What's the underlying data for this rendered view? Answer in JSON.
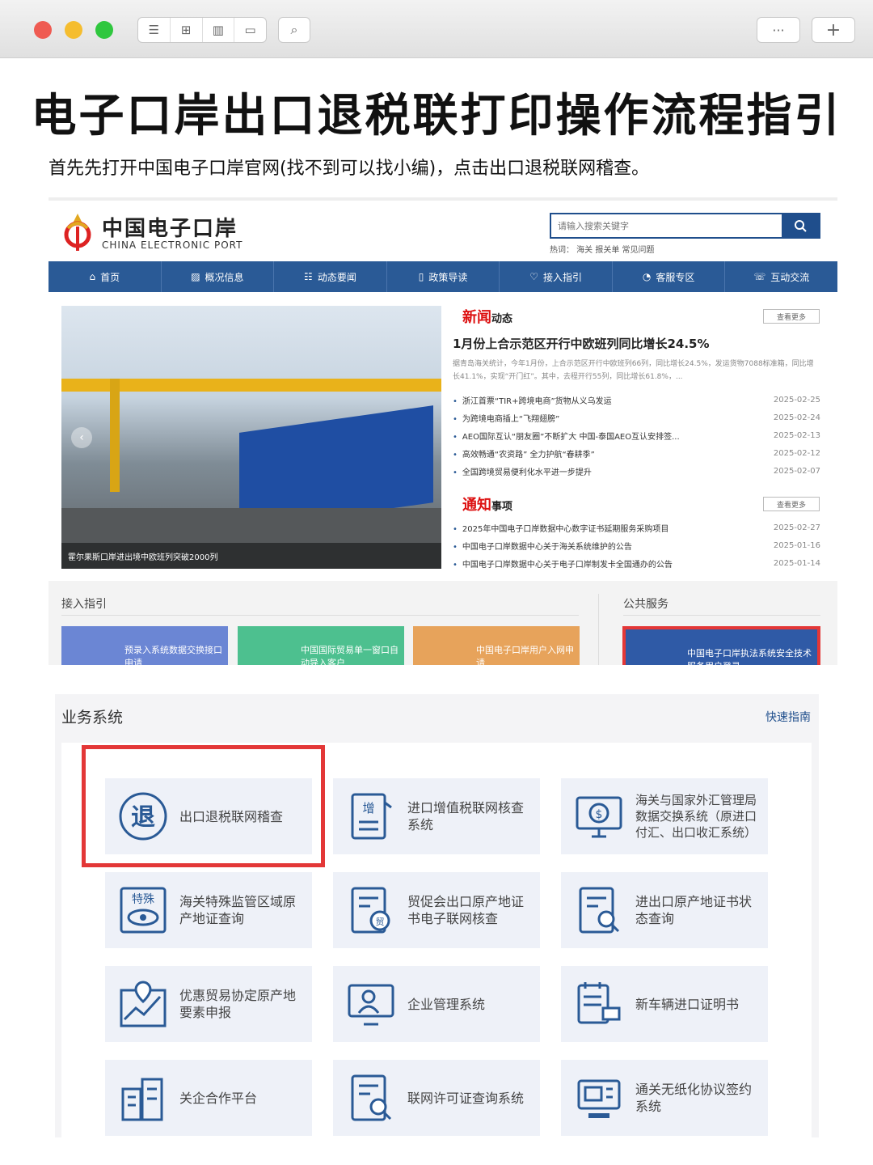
{
  "browser": {
    "toolbar_icons": [
      "list-icon",
      "grid-icon",
      "map-icon",
      "window-icon",
      "search-icon",
      "more-icon",
      "plus-icon"
    ],
    "more_label": "···",
    "plus_label": "+"
  },
  "headline": "电子口岸出口退税联打印操作流程指引",
  "subtitle": "首先先打开中国电子口岸官网(找不到可以找小编)，点击出口退税联网稽查。",
  "site": {
    "logo_cn": "中国电子口岸",
    "logo_en": "CHINA ELECTRONIC PORT",
    "search_placeholder": "请输入搜索关键字",
    "hot": "热词：  海关  报关单  常见问题",
    "nav": [
      "首页",
      "概况信息",
      "动态要闻",
      "政策导读",
      "接入指引",
      "客服专区",
      "互动交流"
    ],
    "photo_caption": "霍尔果斯口岸进出境中欧班列突破2000列",
    "news_title_a": "新闻",
    "news_title_b": "动态",
    "more": "查看更多",
    "headline": "1月份上合示范区开行中欧班列同比增长24.5%",
    "summary": "据青岛海关统计，今年1月份，上合示范区开行中欧班列66列，同比增长24.5%，发运货物7088标准箱，同比增长41.1%，实现“开门红”。其中，去程开行55列，同比增长61.8%，...",
    "news": [
      {
        "t": "浙江首票“TIR+跨境电商”货物从义乌发运",
        "d": "2025-02-25"
      },
      {
        "t": "为跨境电商插上“飞翔翅膀”",
        "d": "2025-02-24"
      },
      {
        "t": "AEO国际互认“朋友圈”不断扩大 中国-泰国AEO互认安排签...",
        "d": "2025-02-13"
      },
      {
        "t": "高效畅通“农资路” 全力护航“春耕季”",
        "d": "2025-02-12"
      },
      {
        "t": "全国跨境贸易便利化水平进一步提升",
        "d": "2025-02-07"
      }
    ],
    "notice_title_a": "通知",
    "notice_title_b": "事项",
    "notices": [
      {
        "t": "2025年中国电子口岸数据中心数字证书延期服务采购项目",
        "d": "2025-02-27"
      },
      {
        "t": "中国电子口岸数据中心关于海关系统维护的公告",
        "d": "2025-01-16"
      },
      {
        "t": "中国电子口岸数据中心关于电子口岸制发卡全国通办的公告",
        "d": "2025-01-14"
      }
    ],
    "access_guide": "接入指引",
    "public_service": "公共服务",
    "tiles": [
      "预录入系统数据交换接口申请",
      "中国国际贸易单一窗口自动导入客户",
      "中国电子口岸用户入网申请"
    ],
    "enforcement": "中国电子口岸执法系统安全技术服务用户登录"
  },
  "business": {
    "title": "业务系统",
    "quick": "快速指南",
    "cards": [
      "出口退税联网稽查",
      "进口增值税联网核查系统",
      "海关与国家外汇管理局数据交换系统（原进口付汇、出口收汇系统）",
      "海关特殊监管区域原产地证查询",
      "贸促会出口原产地证书电子联网核查",
      "进出口原产地证书状态查询",
      "优惠贸易协定原产地要素申报",
      "企业管理系统",
      "新车辆进口证明书",
      "关企合作平台",
      "联网许可证查询系统",
      "通关无纸化协议签约系统"
    ],
    "icon_text": {
      "tui": "退",
      "zeng": "增",
      "teshu": "特殊",
      "mao": "贸"
    }
  },
  "colors": {
    "brand": "#2a5a96",
    "highlight": "#e33737",
    "news_red": "#d11"
  }
}
